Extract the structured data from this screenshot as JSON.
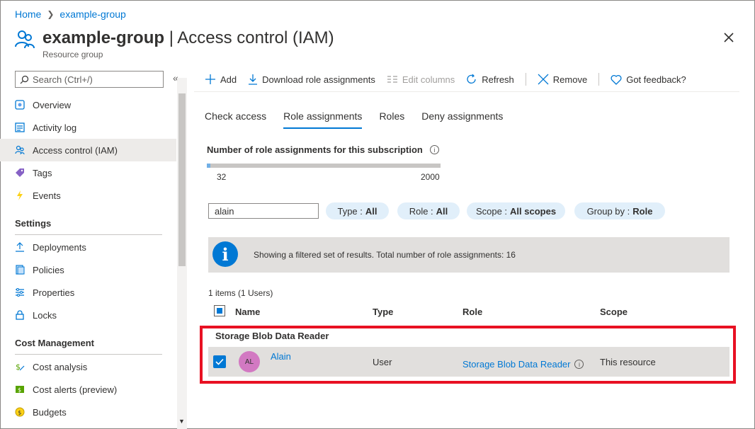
{
  "breadcrumb": {
    "home": "Home",
    "group": "example-group"
  },
  "header": {
    "title_bold": "example-group",
    "title_rest": "| Access control (IAM)",
    "subtitle": "Resource group"
  },
  "sidebar": {
    "search_placeholder": "Search (Ctrl+/)",
    "items": [
      {
        "label": "Overview",
        "icon": "overview-icon"
      },
      {
        "label": "Activity log",
        "icon": "activity-log-icon"
      },
      {
        "label": "Access control (IAM)",
        "icon": "people-icon",
        "active": true
      },
      {
        "label": "Tags",
        "icon": "tag-icon"
      },
      {
        "label": "Events",
        "icon": "lightning-icon"
      }
    ],
    "settings_header": "Settings",
    "settings_items": [
      {
        "label": "Deployments",
        "icon": "upload-icon"
      },
      {
        "label": "Policies",
        "icon": "policy-icon"
      },
      {
        "label": "Properties",
        "icon": "sliders-icon"
      },
      {
        "label": "Locks",
        "icon": "lock-icon"
      }
    ],
    "cost_header": "Cost Management",
    "cost_items": [
      {
        "label": "Cost analysis",
        "icon": "cost-analysis-icon"
      },
      {
        "label": "Cost alerts (preview)",
        "icon": "cost-alerts-icon"
      },
      {
        "label": "Budgets",
        "icon": "budgets-icon"
      }
    ]
  },
  "toolbar": {
    "add": "Add",
    "download": "Download role assignments",
    "edit_columns": "Edit columns",
    "refresh": "Refresh",
    "remove": "Remove",
    "feedback": "Got feedback?"
  },
  "tabs": [
    "Check access",
    "Role assignments",
    "Roles",
    "Deny assignments"
  ],
  "active_tab": "Role assignments",
  "count": {
    "label": "Number of role assignments for this subscription",
    "current": "32",
    "max": "2000",
    "fraction": 0.016
  },
  "filters": {
    "search_value": "alain",
    "type_label": "Type :",
    "type_value": "All",
    "role_label": "Role :",
    "role_value": "All",
    "scope_label": "Scope :",
    "scope_value": "All scopes",
    "group_label": "Group by :",
    "group_value": "Role"
  },
  "banner": {
    "text": "Showing a filtered set of results. Total number of role assignments: 16"
  },
  "table": {
    "items_count": "1 items (1 Users)",
    "columns": {
      "name": "Name",
      "type": "Type",
      "role": "Role",
      "scope": "Scope"
    },
    "group_title": "Storage Blob Data Reader",
    "row": {
      "initials": "AL",
      "name": "Alain",
      "type": "User",
      "role": "Storage Blob Data Reader",
      "scope": "This resource"
    }
  },
  "colors": {
    "accent": "#0078d4",
    "highlight": "#e81123",
    "avatar": "#d279c2",
    "pill": "#e1effa"
  }
}
